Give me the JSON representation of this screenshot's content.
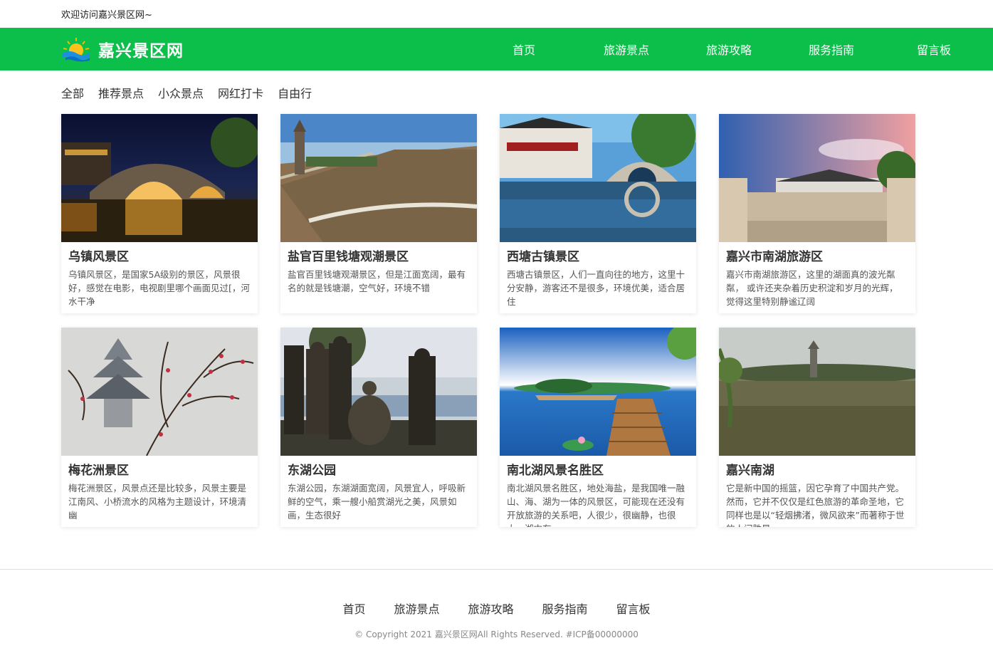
{
  "topbar": {
    "welcome": "欢迎访问嘉兴景区网~"
  },
  "header": {
    "site_name": "嘉兴景区网",
    "nav": [
      "首页",
      "旅游景点",
      "旅游攻略",
      "服务指南",
      "留言板"
    ]
  },
  "filters": [
    "全部",
    "推荐景点",
    "小众景点",
    "网红打卡",
    "自由行"
  ],
  "cards": [
    {
      "title": "乌镇风景区",
      "desc": "乌镇风景区，是国家5A级别的景区，风景很好，感觉在电影，电视剧里哪个画面见过[，河水干净"
    },
    {
      "title": "盐官百里钱塘观潮景区",
      "desc": "盐官百里钱塘观潮景区，但是江面宽阔，最有名的就是钱塘潮，空气好，环境不错"
    },
    {
      "title": "西塘古镇景区",
      "desc": "西塘古镇景区，人们一直向往的地方，这里十分安静，游客还不是很多，环境优美，适合居住"
    },
    {
      "title": "嘉兴市南湖旅游区",
      "desc": "嘉兴市南湖旅游区，这里的湖面真的波光粼粼， 或许还夹杂着历史积淀和岁月的光辉， 觉得这里特别静谧辽阔"
    },
    {
      "title": "梅花洲景区",
      "desc": "梅花洲景区，风景点还是比较多，风景主要是江南风、小桥流水的风格为主题设计，环境清幽"
    },
    {
      "title": "东湖公园",
      "desc": "东湖公园，东湖湖面宽阔，风景宜人，呼吸新鲜的空气，乘一艘小船赏湖光之美，风景如画，生态很好"
    },
    {
      "title": "南北湖风景名胜区",
      "desc": "南北湖风景名胜区，地处海盐，是我国唯一融山、海、湖为一体的风景区，可能现在还没有开放旅游的关系吧，人很少，很幽静，也很大，湖中有"
    },
    {
      "title": "嘉兴南湖",
      "desc": "它是新中国的摇篮，因它孕育了中国共产党。然而，它并不仅仅是红色旅游的革命圣地，它同样也是以“轻烟拂渚，微风欲来”而著称于世的人间胜景。"
    }
  ],
  "footer": {
    "nav": [
      "首页",
      "旅游景点",
      "旅游攻略",
      "服务指南",
      "留言板"
    ],
    "copyright": "© Copyright 2021 嘉兴景区网All Rights Reserved. #ICP备00000000"
  },
  "colors": {
    "brand_green": "#0bbf4a"
  }
}
